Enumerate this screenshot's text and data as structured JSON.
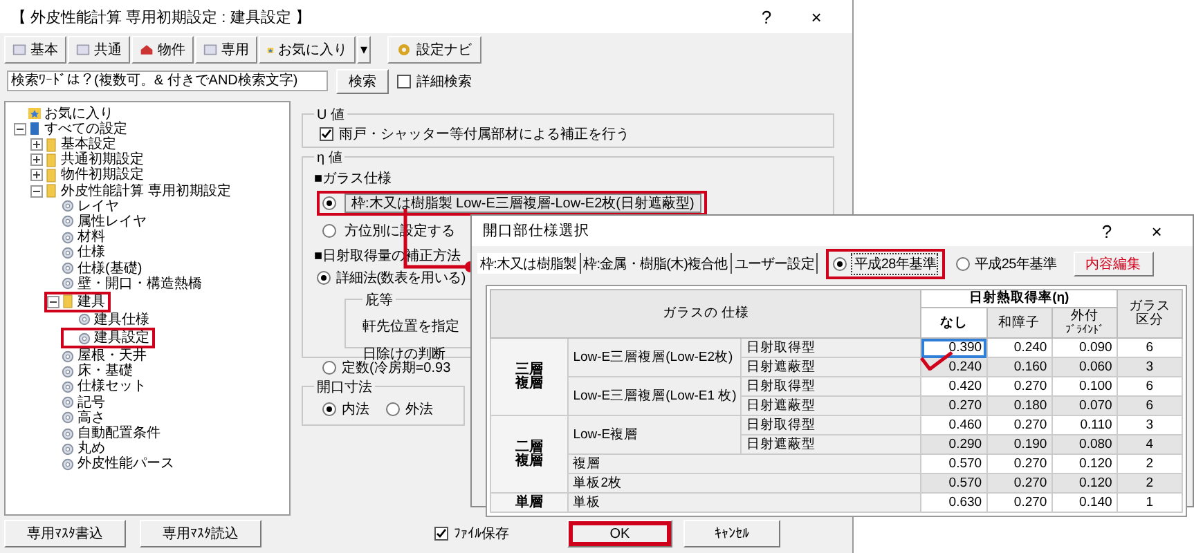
{
  "window": {
    "title": "【 外皮性能計算 専用初期設定 : 建具設定 】",
    "help": "?",
    "close": "×"
  },
  "toolbar": {
    "tabs": [
      {
        "label": "基本",
        "kind": "sheet"
      },
      {
        "label": "共通",
        "kind": "sheet"
      },
      {
        "label": "物件",
        "kind": "house"
      },
      {
        "label": "専用",
        "kind": "sheet"
      },
      {
        "label": "お気に入り",
        "kind": "star"
      }
    ],
    "dropdown": "▾",
    "navi": "設定ナビ"
  },
  "search": {
    "placeholder": "検索ﾜｰﾄﾞは？(複数可。& 付きでAND検索文字)",
    "button": "検索",
    "detail": {
      "label": "詳細検索",
      "checked": false
    }
  },
  "tree": [
    {
      "label": "お気に入り",
      "kind": "favorites",
      "highlighted": false
    },
    {
      "label": "すべての設定",
      "kind": "root",
      "expanded": true,
      "highlighted": false,
      "children": [
        {
          "label": "基本設定",
          "kind": "folder",
          "expanded": false,
          "highlighted": false
        },
        {
          "label": "共通初期設定",
          "kind": "folder",
          "expanded": false,
          "highlighted": false
        },
        {
          "label": "物件初期設定",
          "kind": "folder",
          "expanded": false,
          "highlighted": false
        },
        {
          "label": "外皮性能計算 専用初期設定",
          "kind": "folder",
          "expanded": true,
          "highlighted": false,
          "children": [
            {
              "label": "レイヤ",
              "kind": "item",
              "highlighted": false
            },
            {
              "label": "属性レイヤ",
              "kind": "item",
              "highlighted": false
            },
            {
              "label": "材料",
              "kind": "item",
              "highlighted": false
            },
            {
              "label": "仕様",
              "kind": "item",
              "highlighted": false
            },
            {
              "label": "仕様(基礎)",
              "kind": "item",
              "highlighted": false
            },
            {
              "label": "壁・開口・構造熱橋",
              "kind": "item",
              "highlighted": false
            },
            {
              "label": "建具",
              "kind": "folder",
              "expanded": true,
              "highlighted": true,
              "children": [
                {
                  "label": "建具仕様",
                  "kind": "item",
                  "highlighted": false
                },
                {
                  "label": "建具設定",
                  "kind": "item",
                  "highlighted": true
                }
              ]
            },
            {
              "label": "屋根・天井",
              "kind": "item",
              "highlighted": false
            },
            {
              "label": "床・基礎",
              "kind": "item",
              "highlighted": false
            },
            {
              "label": "仕様セット",
              "kind": "item",
              "highlighted": false
            },
            {
              "label": "記号",
              "kind": "item",
              "highlighted": false
            },
            {
              "label": "高さ",
              "kind": "item",
              "highlighted": false
            },
            {
              "label": "自動配置条件",
              "kind": "item",
              "highlighted": false
            },
            {
              "label": "丸め",
              "kind": "item",
              "highlighted": false
            },
            {
              "label": "外皮性能パース",
              "kind": "item",
              "highlighted": false
            }
          ]
        }
      ]
    }
  ],
  "u_value": {
    "title": "U 値",
    "option": {
      "label": "雨戸・シャッター等付属部材による補正を行う",
      "checked": true
    }
  },
  "eta_value": {
    "title": "η 値",
    "glass_heading": "■ガラス仕様",
    "glass_options": [
      {
        "kind": "field",
        "selected": true,
        "label": "枠:木又は樹脂製 Low-E三層複層-Low-E2枚(日射遮蔽型)",
        "highlighted": true
      },
      {
        "kind": "label",
        "selected": false,
        "label": "方位別に設定する"
      }
    ],
    "correction_heading": "■日射取得量の補正方法",
    "detailed": {
      "label": "詳細法(数表を用いる)",
      "selected": true
    },
    "eaves": {
      "title": "庇等",
      "items": [
        "軒先位置を指定",
        "日除けの判断"
      ]
    },
    "constant": {
      "label": "定数(冷房期=0.93",
      "selected": false
    }
  },
  "opening": {
    "title": "開口寸法",
    "options": [
      {
        "label": "内法",
        "selected": true
      },
      {
        "label": "外法",
        "selected": false
      }
    ]
  },
  "footer": {
    "buttons": [
      "専用ﾏｽﾀ書込",
      "専用ﾏｽﾀ読込"
    ],
    "save": {
      "label": "ﾌｧｲﾙ保存",
      "checked": true
    },
    "ok": {
      "label": "OK",
      "highlighted": true
    },
    "cancel": "ｷｬﾝｾﾙ"
  },
  "dialog": {
    "title": "開口部仕様選択",
    "help": "?",
    "close": "×",
    "tabs": [
      {
        "label": "枠:木又は樹脂製",
        "selected": true
      },
      {
        "label": "枠:金属・樹脂(木)複合他",
        "selected": false
      },
      {
        "label": "ユーザー設定",
        "selected": false
      }
    ],
    "standards": [
      {
        "label": "平成28年基準",
        "selected": true,
        "highlighted": true
      },
      {
        "label": "平成25年基準",
        "selected": false,
        "highlighted": false
      }
    ],
    "edit_button": "内容編集",
    "table": {
      "spec_header": "ガラスの 仕様",
      "eta_header": "日射熱取得率(η)",
      "eta_columns": [
        [
          "なし"
        ],
        [
          "和障子"
        ],
        [
          "外付",
          "ﾌﾞﾗｲﾝﾄﾞ"
        ]
      ],
      "class_header": [
        "ガラス",
        "区分"
      ],
      "groups": [
        {
          "name": [
            "三層",
            "複層"
          ],
          "glasses": [
            {
              "name": "Low-E三層複層(Low-E2枚)",
              "rows": [
                {
                  "type": "日射取得型",
                  "values": [
                    {
                      "text": "0.390",
                      "selected": true
                    },
                    {
                      "text": "0.240",
                      "selected": false
                    },
                    {
                      "text": "0.090",
                      "selected": false
                    }
                  ],
                  "class": "6"
                },
                {
                  "type": "日射遮蔽型",
                  "values": [
                    {
                      "text": "0.240",
                      "selected": false
                    },
                    {
                      "text": "0.160",
                      "selected": false
                    },
                    {
                      "text": "0.060",
                      "selected": false
                    }
                  ],
                  "class": "3"
                }
              ]
            },
            {
              "name": "Low-E三層複層(Low-E1 枚)",
              "rows": [
                {
                  "type": "日射取得型",
                  "values": [
                    {
                      "text": "0.420",
                      "selected": false
                    },
                    {
                      "text": "0.270",
                      "selected": false
                    },
                    {
                      "text": "0.100",
                      "selected": false
                    }
                  ],
                  "class": "6"
                },
                {
                  "type": "日射遮蔽型",
                  "values": [
                    {
                      "text": "0.270",
                      "selected": false
                    },
                    {
                      "text": "0.180",
                      "selected": false
                    },
                    {
                      "text": "0.070",
                      "selected": false
                    }
                  ],
                  "class": "6"
                }
              ]
            }
          ]
        },
        {
          "name": [
            "二層",
            "複層"
          ],
          "glasses": [
            {
              "name": "Low-E複層",
              "rows": [
                {
                  "type": "日射取得型",
                  "values": [
                    {
                      "text": "0.460",
                      "selected": false
                    },
                    {
                      "text": "0.270",
                      "selected": false
                    },
                    {
                      "text": "0.110",
                      "selected": false
                    }
                  ],
                  "class": "3"
                },
                {
                  "type": "日射遮蔽型",
                  "values": [
                    {
                      "text": "0.290",
                      "selected": false
                    },
                    {
                      "text": "0.190",
                      "selected": false
                    },
                    {
                      "text": "0.080",
                      "selected": false
                    }
                  ],
                  "class": "4"
                }
              ]
            },
            {
              "name": "複層",
              "rows": [
                {
                  "values": [
                    {
                      "text": "0.570",
                      "selected": false
                    },
                    {
                      "text": "0.270",
                      "selected": false
                    },
                    {
                      "text": "0.120",
                      "selected": false
                    }
                  ],
                  "class": "2"
                }
              ]
            },
            {
              "name": "単板2枚",
              "rows": [
                {
                  "values": [
                    {
                      "text": "0.570",
                      "selected": false
                    },
                    {
                      "text": "0.270",
                      "selected": false
                    },
                    {
                      "text": "0.120",
                      "selected": false
                    }
                  ],
                  "class": "2"
                }
              ]
            }
          ]
        },
        {
          "name": [
            "単層"
          ],
          "glasses": [
            {
              "name": "単板",
              "rows": [
                {
                  "values": [
                    {
                      "text": "0.630",
                      "selected": false
                    },
                    {
                      "text": "0.270",
                      "selected": false
                    },
                    {
                      "text": "0.140",
                      "selected": false
                    }
                  ],
                  "class": "1"
                }
              ]
            }
          ]
        }
      ]
    }
  }
}
